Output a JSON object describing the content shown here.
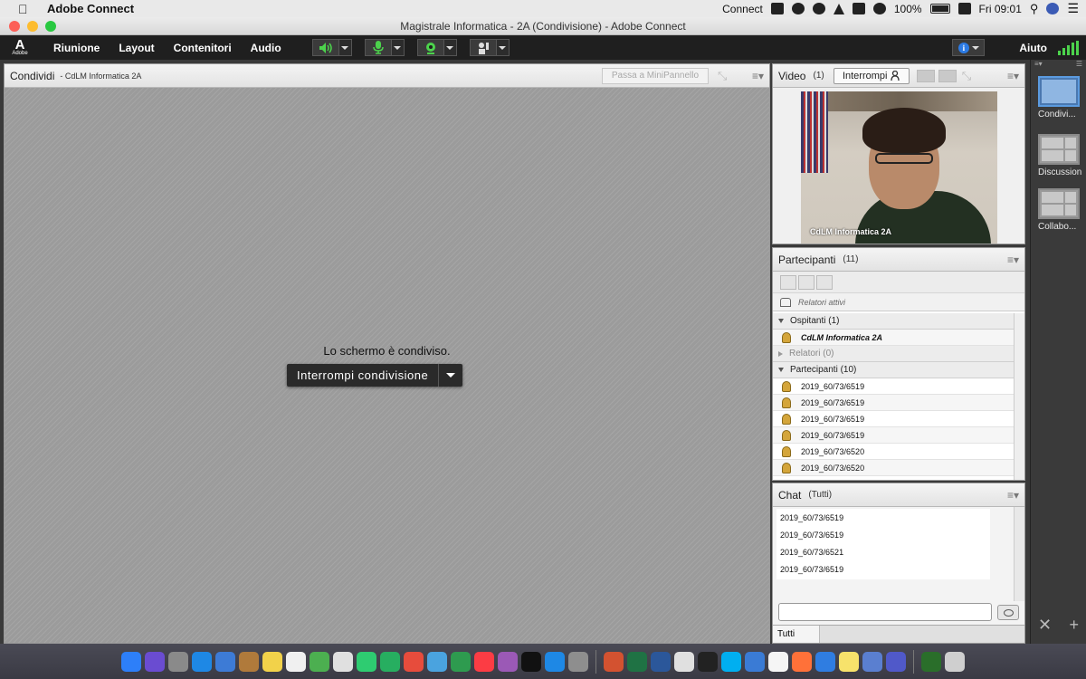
{
  "menubar": {
    "app_name": "Adobe Connect",
    "status_app": "Connect",
    "battery": "100%",
    "clock": "Fri 09:01"
  },
  "window": {
    "title": "Magistrale Informatica - 2A (Condivisione) - Adobe Connect"
  },
  "toolbar": {
    "logo_letter": "A",
    "logo_text": "Adobe",
    "menus": [
      "Riunione",
      "Layout",
      "Contenitori",
      "Audio"
    ],
    "help_label": "Aiuto",
    "accent_green": "#4cd34c"
  },
  "share_pod": {
    "title": "Condividi",
    "subtitle": "- CdLM Informatica 2A",
    "mini_panel_button": "Passa a MiniPannello",
    "message": "Lo schermo è condiviso.",
    "stop_button": "Interrompi condivisione"
  },
  "video_pod": {
    "title": "Video",
    "count": "(1)",
    "stop_button": "Interrompi",
    "camera_label": "CdLM Informatica 2A"
  },
  "participants_pod": {
    "title": "Partecipanti",
    "count": "(11)",
    "active_speakers": "Relatori attivi",
    "groups": {
      "hosts": "Ospitanti (1)",
      "presenters": "Relatori (0)",
      "participants": "Partecipanti (10)"
    },
    "host_name": "CdLM Informatica 2A",
    "participant_names": [
      "2019_60/73/6519",
      "2019_60/73/6519",
      "2019_60/73/6519",
      "2019_60/73/6519",
      "2019_60/73/6520",
      "2019_60/73/6520"
    ]
  },
  "chat_pod": {
    "title": "Chat",
    "scope": "(Tutti)",
    "messages": [
      "2019_60/73/6519",
      "2019_60/73/6519",
      "2019_60/73/6521",
      "2019_60/73/6519"
    ],
    "input_placeholder": "",
    "tab": "Tutti"
  },
  "layouts": {
    "items": [
      {
        "label": "Condivi..."
      },
      {
        "label": "Discussione"
      },
      {
        "label": "Collabo..."
      }
    ]
  },
  "dock": {
    "icons": [
      "finder-icon",
      "siri-icon",
      "launchpad-icon",
      "safari-icon",
      "preview-icon",
      "contacts-icon",
      "notes-icon",
      "reminders-icon",
      "maps-icon",
      "photos-icon",
      "messages-icon",
      "facetime-icon",
      "news-icon",
      "keynote-icon",
      "numbers-icon",
      "itunes-icon",
      "podcasts-icon",
      "tv-icon",
      "appstore-icon",
      "preferences-icon",
      "powerpoint-icon",
      "excel-icon",
      "word-icon",
      "chrome-icon",
      "terminal-icon",
      "skype-icon",
      "mail-icon",
      "calendar-icon",
      "firefox-icon",
      "connect-icon",
      "stickies-icon",
      "finder2-icon",
      "teams-icon",
      "adobe-icon",
      "trash-icon"
    ]
  }
}
